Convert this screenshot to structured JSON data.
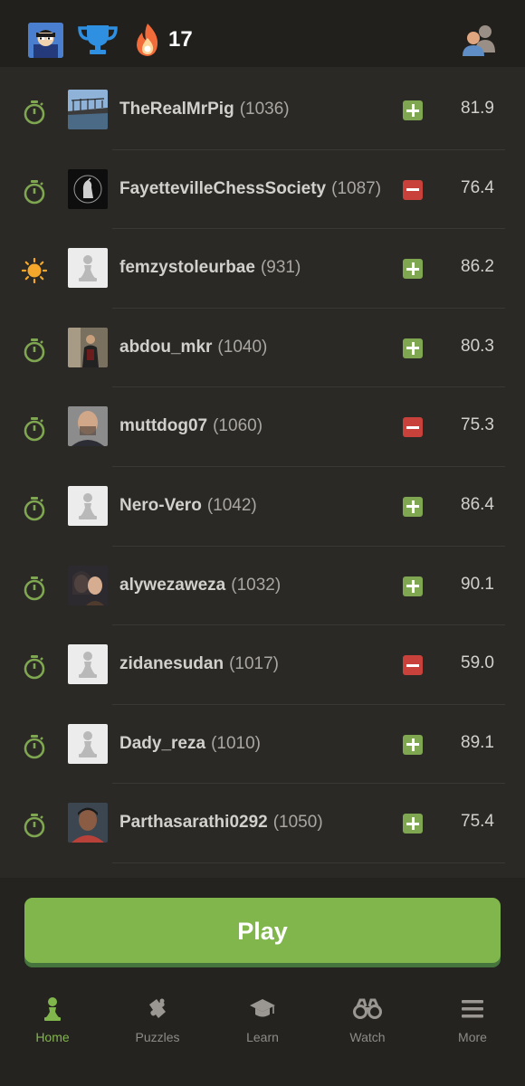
{
  "header": {
    "streak_count": "17",
    "avatar_icon": "user-avatar",
    "trophy_icon": "trophy-icon",
    "streak_icon": "flame-icon",
    "friends_icon": "friends-icon"
  },
  "opponents": [
    {
      "name": "TheRealMrPig",
      "rating": "(1036)",
      "mode": "stopwatch-icon",
      "change": "plus",
      "accuracy": "81.9",
      "pic": "photo-bridge"
    },
    {
      "name": "FayettevilleChessSociety",
      "rating": "(1087)",
      "mode": "stopwatch-icon",
      "change": "minus",
      "accuracy": "76.4",
      "pic": "logo-dark"
    },
    {
      "name": "femzystoleurbae",
      "rating": "(931)",
      "mode": "sun-icon",
      "change": "plus",
      "accuracy": "86.2",
      "pic": "pawn-default"
    },
    {
      "name": "abdou_mkr",
      "rating": "(1040)",
      "mode": "stopwatch-icon",
      "change": "plus",
      "accuracy": "80.3",
      "pic": "photo-person"
    },
    {
      "name": "muttdog07",
      "rating": "(1060)",
      "mode": "stopwatch-icon",
      "change": "minus",
      "accuracy": "75.3",
      "pic": "photo-face"
    },
    {
      "name": "Nero-Vero",
      "rating": "(1042)",
      "mode": "stopwatch-icon",
      "change": "plus",
      "accuracy": "86.4",
      "pic": "pawn-default"
    },
    {
      "name": "alywezaweza",
      "rating": "(1032)",
      "mode": "stopwatch-icon",
      "change": "plus",
      "accuracy": "90.1",
      "pic": "photo-couple"
    },
    {
      "name": "zidanesudan",
      "rating": "(1017)",
      "mode": "stopwatch-icon",
      "change": "minus",
      "accuracy": "59.0",
      "pic": "pawn-default"
    },
    {
      "name": "Dady_reza",
      "rating": "(1010)",
      "mode": "stopwatch-icon",
      "change": "plus",
      "accuracy": "89.1",
      "pic": "pawn-default"
    },
    {
      "name": "Parthasarathi0292",
      "rating": "(1050)",
      "mode": "stopwatch-icon",
      "change": "plus",
      "accuracy": "75.4",
      "pic": "photo-person-red"
    }
  ],
  "play_button": {
    "label": "Play"
  },
  "nav": {
    "items": [
      {
        "label": "Home",
        "icon": "pawn-icon",
        "active": true
      },
      {
        "label": "Puzzles",
        "icon": "puzzle-icon",
        "active": false
      },
      {
        "label": "Learn",
        "icon": "graduation-cap-icon",
        "active": false
      },
      {
        "label": "Watch",
        "icon": "binoculars-icon",
        "active": false
      },
      {
        "label": "More",
        "icon": "menu-icon",
        "active": false
      }
    ]
  },
  "colors": {
    "accent": "#81b64c",
    "plus": "#7fa650",
    "minus": "#c8413b",
    "background": "#2b2926",
    "sun": "#f4a72a"
  }
}
